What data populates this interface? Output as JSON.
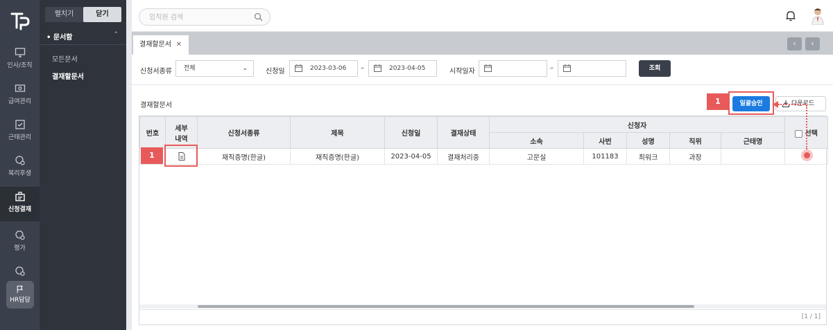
{
  "rail": {
    "items": [
      {
        "label": "인사/조직",
        "icon": "monitor-icon"
      },
      {
        "label": "급여관리",
        "icon": "money-icon"
      },
      {
        "label": "근태관리",
        "icon": "calendar-check-icon"
      },
      {
        "label": "복리후생",
        "icon": "benefit-icon"
      },
      {
        "label": "신청결재",
        "icon": "approval-icon"
      },
      {
        "label": "평가",
        "icon": "evaluation-icon"
      },
      {
        "label": "",
        "icon": "settings-badge-icon"
      }
    ],
    "hr_label": "HR담당"
  },
  "sub": {
    "expand_label": "펼치기",
    "collapse_label": "닫기",
    "section": "• 문서함",
    "links": [
      "모든문서",
      "결재할문서"
    ]
  },
  "top": {
    "search_placeholder": "임직원 검색"
  },
  "tabs": [
    {
      "label": "결재할문서"
    }
  ],
  "filters": {
    "doc_type_label": "신청서종류",
    "doc_type_value": "전체",
    "apply_date_label": "신청일",
    "apply_from": "2023-03-06",
    "apply_to": "2023-04-05",
    "start_date_label": "시작일자",
    "start_from": "",
    "start_to": "",
    "dash": "–",
    "search_btn": "조회"
  },
  "section": {
    "title": "결재할문서",
    "approve_btn": "일괄승인",
    "download_btn": "다운로드"
  },
  "table": {
    "headers": {
      "no": "번호",
      "detail_1": "세부",
      "detail_2": "내역",
      "doc_type": "신청서종류",
      "title": "제목",
      "apply_date": "신청일",
      "status": "결재상태",
      "applicant": "신청자",
      "dept": "소속",
      "emp_no": "사번",
      "name": "성명",
      "position": "직위",
      "work_name": "근태명",
      "select": "선택"
    },
    "rows": [
      {
        "doc_type": "재직증명(한글)",
        "title": "재직증명(한글)",
        "apply_date": "2023-04-05",
        "status": "결재처리중",
        "dept": "고문실",
        "emp_no": "101183",
        "name": "최워크",
        "position": "과장",
        "work_name": ""
      }
    ],
    "pagination": "[1 / 1]"
  },
  "annotations": {
    "step_1a": "1",
    "step_1b": "1"
  },
  "colors": {
    "accent": "#1c7be0",
    "annotation": "#e85a5a",
    "sidebar": "#3a404b"
  }
}
